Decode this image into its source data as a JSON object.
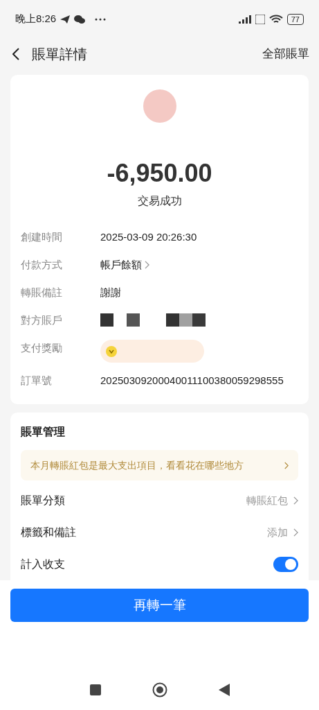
{
  "status_bar": {
    "time": "晚上8:26",
    "battery": "77"
  },
  "header": {
    "title": "賬單詳情",
    "action": "全部賬單"
  },
  "summary": {
    "amount": "-6,950.00",
    "status": "交易成功"
  },
  "details": [
    {
      "kind": "text",
      "label": "創建時間",
      "value": "2025-03-09 20:26:30"
    },
    {
      "kind": "link",
      "label": "付款方式",
      "value": "帳戶餘額"
    },
    {
      "kind": "text",
      "label": "轉賬備註",
      "value": "謝謝"
    },
    {
      "kind": "redacted",
      "label": "對方賬戶"
    },
    {
      "kind": "reward",
      "label": "支付獎勵"
    },
    {
      "kind": "text",
      "label": "訂單號",
      "value": "20250309200040011100380059298555"
    }
  ],
  "management": {
    "title": "賬單管理",
    "tip": "本月轉賬紅包是最大支出項目，看看花在哪些地方",
    "rows": [
      {
        "kind": "link",
        "label": "賬單分類",
        "value": "轉賬紅包"
      },
      {
        "kind": "link",
        "label": "標籤和備註",
        "value": "添加"
      },
      {
        "kind": "toggle",
        "label": "計入收支",
        "on": true
      }
    ]
  },
  "button": "再轉一筆"
}
